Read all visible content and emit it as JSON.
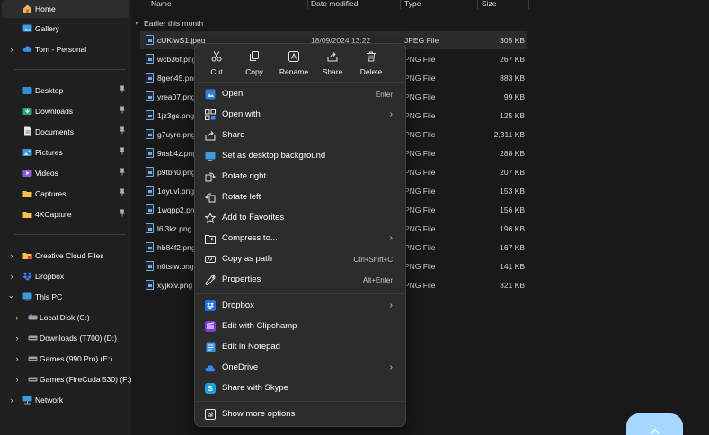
{
  "sidebar": {
    "items": [
      {
        "label": "Home",
        "icon": "home-icon",
        "pinned": false
      },
      {
        "label": "Gallery",
        "icon": "gallery-icon",
        "pinned": false
      },
      {
        "label": "Tom - Personal",
        "icon": "cloud-icon",
        "pinned": false
      },
      {
        "label": "Desktop",
        "icon": "desktop-icon",
        "pinned": true
      },
      {
        "label": "Downloads",
        "icon": "downloads-icon",
        "pinned": true
      },
      {
        "label": "Documents",
        "icon": "documents-icon",
        "pinned": true
      },
      {
        "label": "Pictures",
        "icon": "pictures-icon",
        "pinned": true
      },
      {
        "label": "Videos",
        "icon": "videos-icon",
        "pinned": true
      },
      {
        "label": "Captures",
        "icon": "folder-icon",
        "pinned": true
      },
      {
        "label": "4KCapture",
        "icon": "folder-icon",
        "pinned": true
      },
      {
        "label": "Creative Cloud Files",
        "icon": "creative-cloud-icon",
        "pinned": false
      },
      {
        "label": "Dropbox",
        "icon": "dropbox-icon",
        "pinned": false
      },
      {
        "label": "This PC",
        "icon": "pc-icon",
        "pinned": false
      },
      {
        "label": "Local Disk (C:)",
        "icon": "drive-icon",
        "pinned": false
      },
      {
        "label": "Downloads (T700) (D:)",
        "icon": "drive-icon",
        "pinned": false
      },
      {
        "label": "Games (990 Pro) (E:)",
        "icon": "drive-icon",
        "pinned": false
      },
      {
        "label": "Games (FireCuda 530) (F:)",
        "icon": "drive-icon",
        "pinned": false
      },
      {
        "label": "Network",
        "icon": "network-icon",
        "pinned": false
      }
    ]
  },
  "columns": {
    "name": "Name",
    "date": "Date modified",
    "type": "Type",
    "size": "Size"
  },
  "group": {
    "label": "Earlier this month"
  },
  "files": [
    {
      "name": "cUKfwS1.jpeg",
      "date": "18/09/2024 13:22",
      "type": "JPEG File",
      "size": "305 KB"
    },
    {
      "name": "wcb36f.png",
      "date": "",
      "type": "PNG File",
      "size": "267 KB"
    },
    {
      "name": "8gen45.png",
      "date": "",
      "type": "PNG File",
      "size": "883 KB"
    },
    {
      "name": "yrea07.png",
      "date": "",
      "type": "PNG File",
      "size": "99 KB"
    },
    {
      "name": "1jz3gs.png",
      "date": "",
      "type": "PNG File",
      "size": "125 KB"
    },
    {
      "name": "g7uyre.png",
      "date": "",
      "type": "PNG File",
      "size": "2,311 KB"
    },
    {
      "name": "9nsb4z.png",
      "date": "",
      "type": "PNG File",
      "size": "288 KB"
    },
    {
      "name": "p9tbh0.png",
      "date": "",
      "type": "PNG File",
      "size": "207 KB"
    },
    {
      "name": "1oyuvl.png",
      "date": "",
      "type": "PNG File",
      "size": "153 KB"
    },
    {
      "name": "1wqpp2.png",
      "date": "",
      "type": "PNG File",
      "size": "156 KB"
    },
    {
      "name": "l6i3kz.png",
      "date": "",
      "type": "PNG File",
      "size": "196 KB"
    },
    {
      "name": "hb84f2.png",
      "date": "",
      "type": "PNG File",
      "size": "167 KB"
    },
    {
      "name": "n0tstw.png",
      "date": "",
      "type": "PNG File",
      "size": "141 KB"
    },
    {
      "name": "xyjkxv.png",
      "date": "",
      "type": "PNG File",
      "size": "321 KB"
    }
  ],
  "context_menu": {
    "toolbar": [
      {
        "label": "Cut",
        "icon": "cut-icon"
      },
      {
        "label": "Copy",
        "icon": "copy-icon"
      },
      {
        "label": "Rename",
        "icon": "rename-icon"
      },
      {
        "label": "Share",
        "icon": "share-icon"
      },
      {
        "label": "Delete",
        "icon": "delete-icon"
      }
    ],
    "items": [
      {
        "label": "Open",
        "shortcut": "Enter",
        "submenu": false,
        "icon": "open-icon"
      },
      {
        "label": "Open with",
        "shortcut": "",
        "submenu": true,
        "icon": "open-with-icon"
      },
      {
        "label": "Share",
        "shortcut": "",
        "submenu": false,
        "icon": "share-icon"
      },
      {
        "label": "Set as desktop background",
        "shortcut": "",
        "submenu": false,
        "icon": "desktop-background-icon"
      },
      {
        "label": "Rotate right",
        "shortcut": "",
        "submenu": false,
        "icon": "rotate-right-icon"
      },
      {
        "label": "Rotate left",
        "shortcut": "",
        "submenu": false,
        "icon": "rotate-left-icon"
      },
      {
        "label": "Add to Favorites",
        "shortcut": "",
        "submenu": false,
        "icon": "star-icon"
      },
      {
        "label": "Compress to...",
        "shortcut": "",
        "submenu": true,
        "icon": "compress-icon"
      },
      {
        "label": "Copy as path",
        "shortcut": "Ctrl+Shift+C",
        "submenu": false,
        "icon": "copy-path-icon"
      },
      {
        "label": "Properties",
        "shortcut": "Alt+Enter",
        "submenu": false,
        "icon": "properties-icon"
      },
      {
        "label": "Dropbox",
        "shortcut": "",
        "submenu": true,
        "icon": "dropbox-icon"
      },
      {
        "label": "Edit with Clipchamp",
        "shortcut": "",
        "submenu": false,
        "icon": "clipchamp-icon"
      },
      {
        "label": "Edit in Notepad",
        "shortcut": "",
        "submenu": false,
        "icon": "notepad-icon"
      },
      {
        "label": "OneDrive",
        "shortcut": "",
        "submenu": true,
        "icon": "onedrive-icon"
      },
      {
        "label": "Share with Skype",
        "shortcut": "",
        "submenu": false,
        "icon": "skype-icon"
      },
      {
        "label": "Show more options",
        "shortcut": "",
        "submenu": false,
        "icon": "more-options-icon"
      }
    ]
  },
  "colors": {
    "sidebar_bg": "#1f1f1f",
    "main_bg": "#191919",
    "menu_bg": "#2c2c2c",
    "accent_blue": "#4aa3ff",
    "folder_yellow": "#f2c14e",
    "fab": "#a8d8ff"
  }
}
